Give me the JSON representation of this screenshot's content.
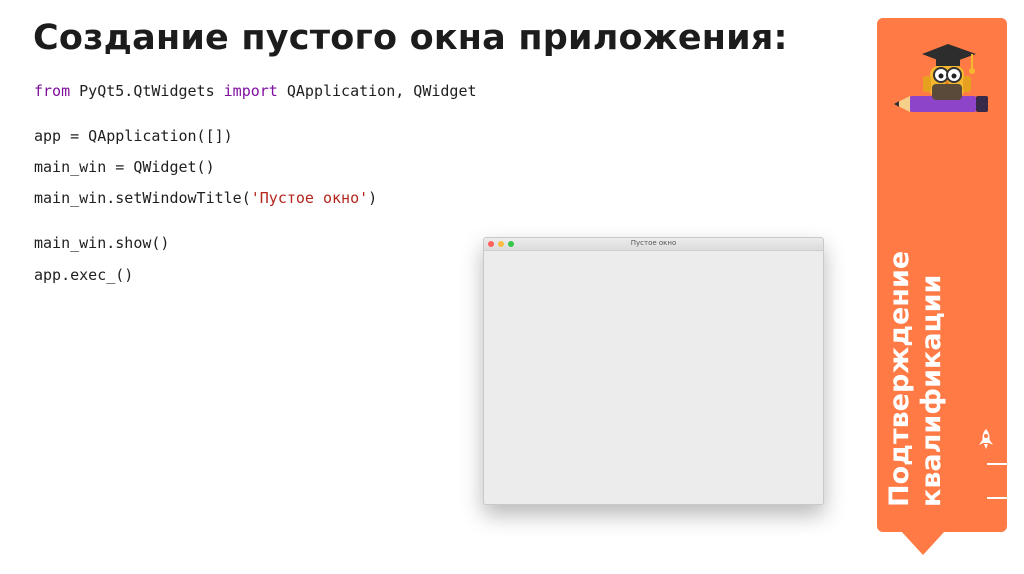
{
  "slide": {
    "title": "Создание пустого окна приложения:"
  },
  "code": {
    "line1": {
      "kw_from": "from",
      "module": " PyQt5.QtWidgets ",
      "kw_import": "import",
      "names": " QApplication, QWidget"
    },
    "line2": "app = QApplication([])",
    "line3": "main_win = QWidget()",
    "line4": {
      "prefix": "main_win.setWindowTitle(",
      "string": "'Пустое окно'",
      "suffix": ")"
    },
    "line5": "main_win.show()",
    "line6": "app.exec_()"
  },
  "window_preview": {
    "title": "Пустое окно"
  },
  "sidebar": {
    "label_line1": "Подтверждение",
    "label_line2": "квалификации",
    "accent_color": "#ff7a45",
    "icons": [
      "mascot-owl-icon",
      "rocket-icon"
    ]
  },
  "colors": {
    "keyword": "#7f0f9e",
    "string": "#b3261e"
  }
}
